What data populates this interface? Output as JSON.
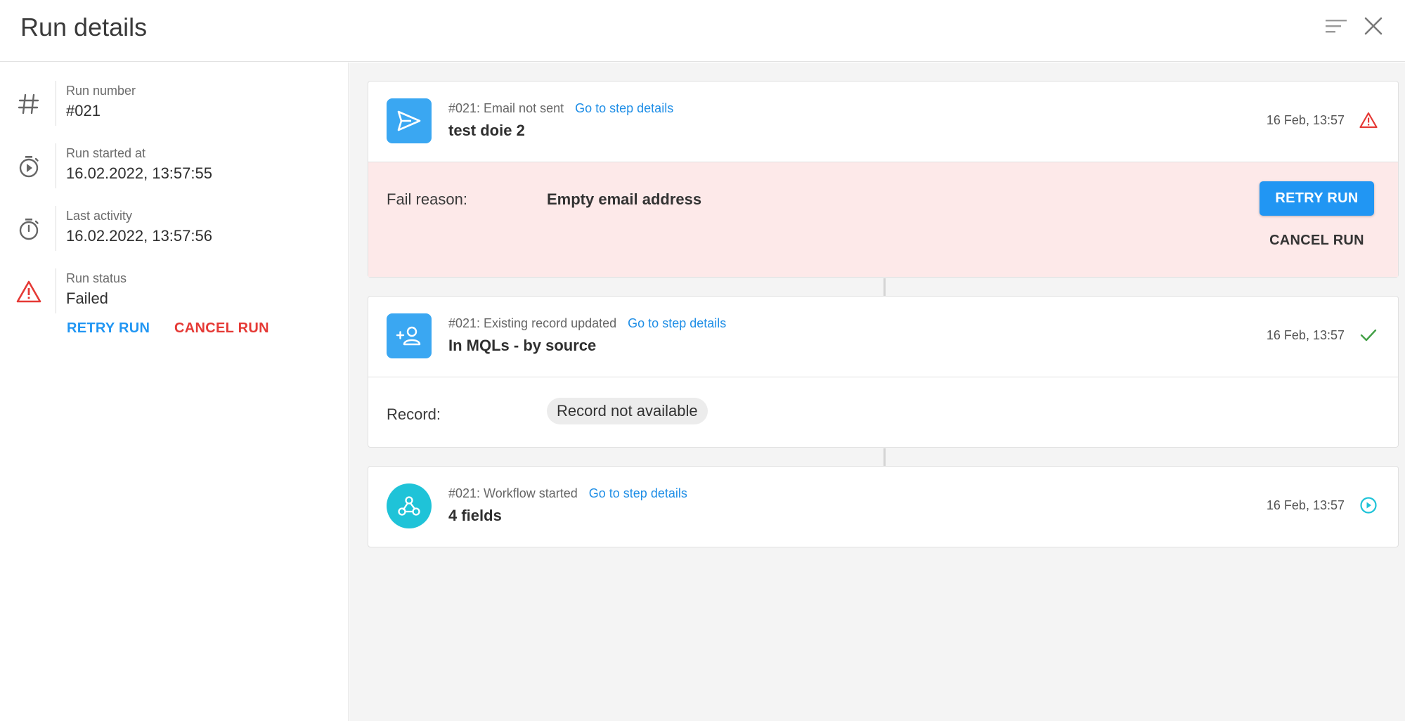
{
  "header": {
    "title": "Run details"
  },
  "run_info": [
    {
      "icon": "hash-icon",
      "label": "Run number",
      "value": "#021"
    },
    {
      "icon": "timer-play-icon",
      "label": "Run started at",
      "value": "16.02.2022, 13:57:55"
    },
    {
      "icon": "timer-icon",
      "label": "Last activity",
      "value": "16.02.2022, 13:57:56"
    },
    {
      "icon": "warning-icon",
      "label": "Run status",
      "value": "Failed"
    }
  ],
  "left_actions": {
    "retry_label": "RETRY RUN",
    "cancel_label": "CANCEL RUN"
  },
  "steps": [
    {
      "icon": "send-icon",
      "subtitle": "#021: Email not sent",
      "link": "Go to step details",
      "name": "test doie 2",
      "time": "16 Feb, 13:57",
      "status": "warning-icon",
      "detail_label": "Fail reason:",
      "detail_value": "Empty email address",
      "retry_label": "RETRY RUN",
      "cancel_label": "CANCEL RUN"
    },
    {
      "icon": "person-add-icon",
      "subtitle": "#021: Existing record updated",
      "link": "Go to step details",
      "name": "In MQLs - by source",
      "time": "16 Feb, 13:57",
      "status": "check-icon",
      "detail_label": "Record:",
      "detail_value": "Record not available"
    },
    {
      "icon": "webhook-icon",
      "subtitle": "#021: Workflow started",
      "link": "Go to step details",
      "name": "4 fields",
      "time": "16 Feb, 13:57",
      "status": "play-circle-icon"
    }
  ],
  "colors": {
    "accent": "#2196f3",
    "link": "#1f8ee6",
    "danger": "#e53935",
    "success": "#43a047",
    "teal": "#1fc3d8",
    "fail_bg": "#fde9e9"
  }
}
